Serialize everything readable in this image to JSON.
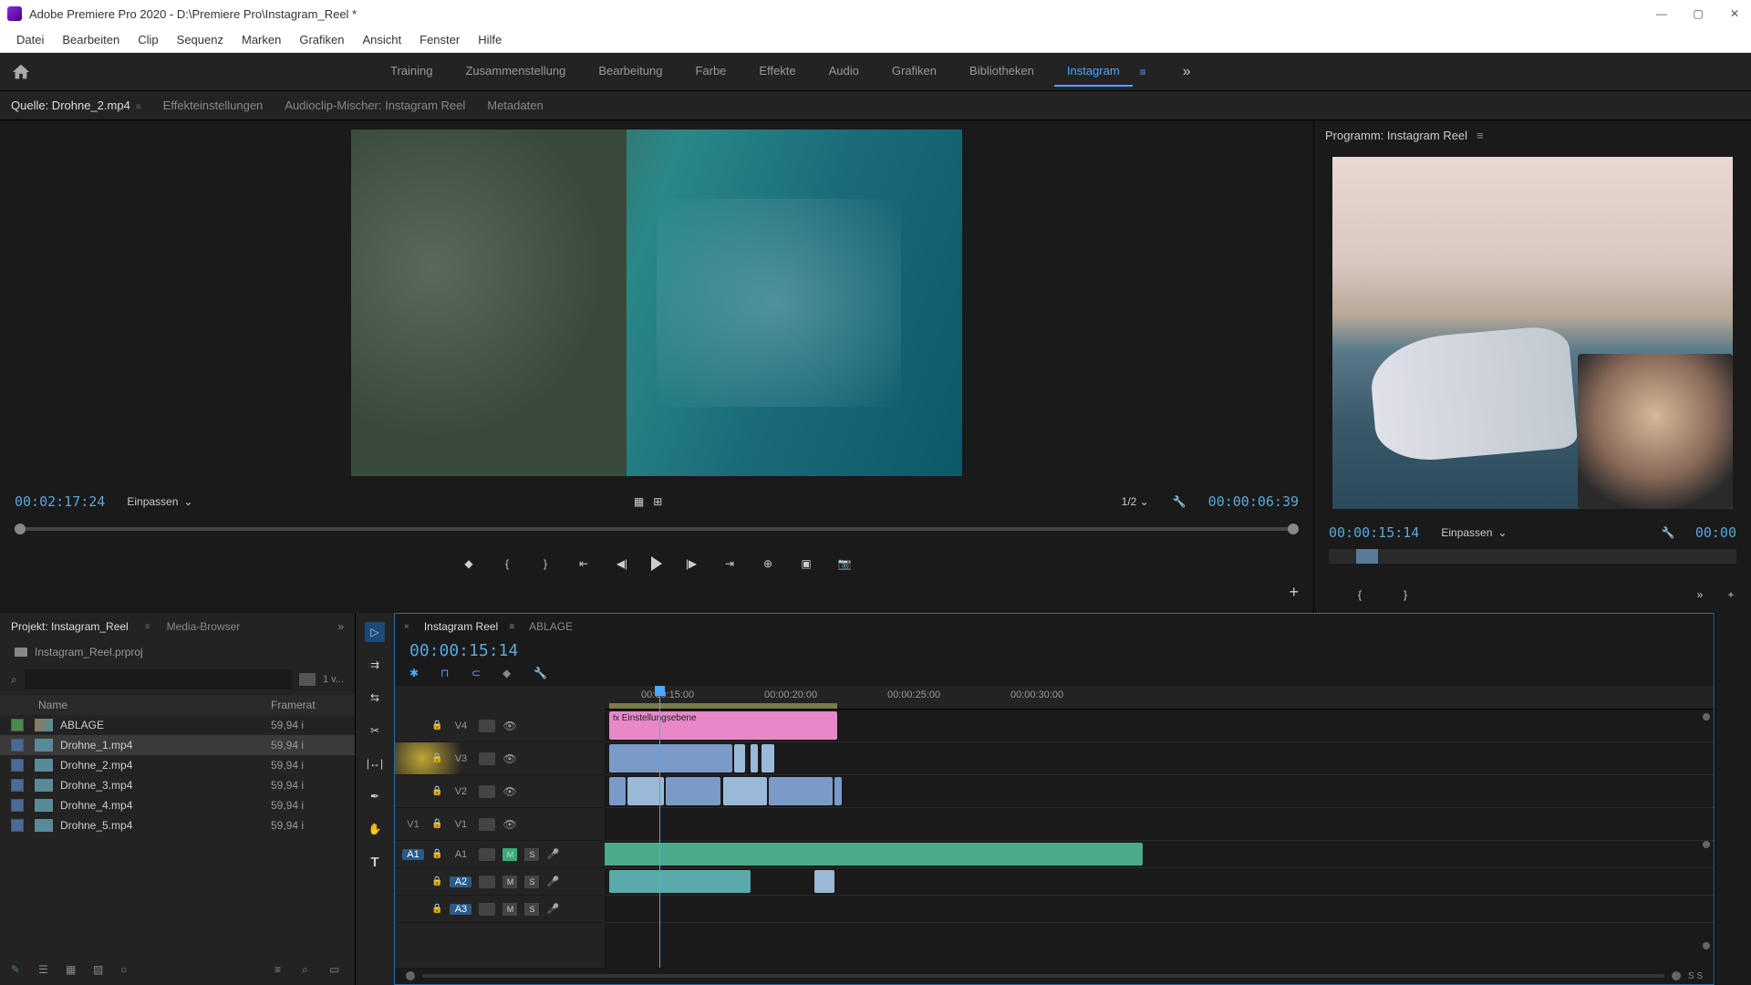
{
  "title": "Adobe Premiere Pro 2020 - D:\\Premiere Pro\\Instagram_Reel *",
  "menu": [
    "Datei",
    "Bearbeiten",
    "Clip",
    "Sequenz",
    "Marken",
    "Grafiken",
    "Ansicht",
    "Fenster",
    "Hilfe"
  ],
  "workspaces": [
    "Training",
    "Zusammenstellung",
    "Bearbeitung",
    "Farbe",
    "Effekte",
    "Audio",
    "Grafiken",
    "Bibliotheken",
    "Instagram"
  ],
  "workspace_active": 8,
  "source_tabs": {
    "items": [
      "Quelle: Drohne_2.mp4",
      "Effekteinstellungen",
      "Audioclip-Mischer: Instagram Reel",
      "Metadaten"
    ],
    "active": 0
  },
  "source": {
    "tc_left": "00:02:17:24",
    "fit": "Einpassen",
    "ratio": "1/2",
    "tc_right": "00:00:06:39"
  },
  "program": {
    "title": "Programm: Instagram Reel",
    "tc_left": "00:00:15:14",
    "fit": "Einpassen",
    "tc_right": "00:00"
  },
  "project": {
    "tab_active": "Projekt: Instagram_Reel",
    "tab_other": "Media-Browser",
    "filename": "Instagram_Reel.prproj",
    "count": "1 v...",
    "cols": {
      "name": "Name",
      "framerate": "Framerat"
    },
    "items": [
      {
        "swatch": "g",
        "seq": true,
        "name": "ABLAGE",
        "fr": "59,94 i"
      },
      {
        "swatch": "b",
        "seq": false,
        "name": "Drohne_1.mp4",
        "fr": "59,94 i",
        "sel": true
      },
      {
        "swatch": "b",
        "seq": false,
        "name": "Drohne_2.mp4",
        "fr": "59,94 i"
      },
      {
        "swatch": "b",
        "seq": false,
        "name": "Drohne_3.mp4",
        "fr": "59,94 i"
      },
      {
        "swatch": "b",
        "seq": false,
        "name": "Drohne_4.mp4",
        "fr": "59,94 i"
      },
      {
        "swatch": "b",
        "seq": false,
        "name": "Drohne_5.mp4",
        "fr": "59,94 i"
      }
    ]
  },
  "timeline": {
    "tabs": [
      "Instagram Reel",
      "ABLAGE"
    ],
    "tc": "00:00:15:14",
    "ruler": [
      "00:00:15:00",
      "00:00:20:00",
      "00:00:25:00",
      "00:00:30:00"
    ],
    "adj_label": "Einstellungsebene",
    "ss": "S S",
    "video_tracks": [
      "V4",
      "V3",
      "V2",
      "V1"
    ],
    "audio_tracks": [
      "A1",
      "A2",
      "A3"
    ]
  }
}
